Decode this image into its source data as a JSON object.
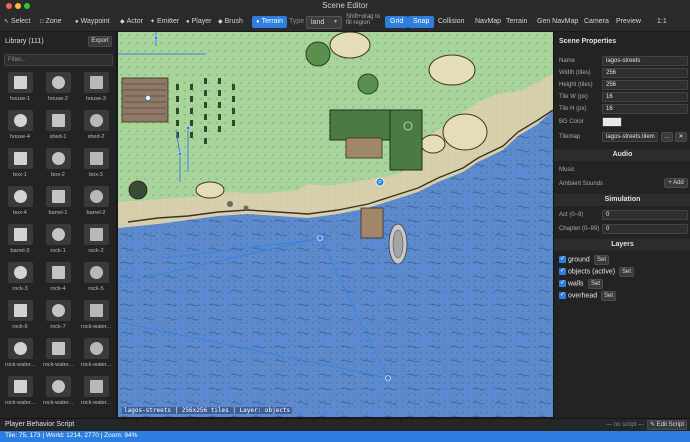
{
  "window": {
    "title": "Scene Editor"
  },
  "toolbar": {
    "select": "Select",
    "zone": "Zone",
    "waypoint": "Waypoint",
    "actor": "Actor",
    "emitter": "Emitter",
    "player": "Player",
    "brush": "Brush",
    "terrain": "Terrain",
    "type_label": "Type",
    "type_value": "land",
    "hint": "Shift+drag to fill region",
    "grid": "Grid",
    "snap": "Snap",
    "collision": "Collision",
    "navmap": "NavMap",
    "terrain2": "Terrain",
    "gen_navmap": "Gen NavMap",
    "camera": "Camera",
    "preview": "Preview",
    "zoom_ratio": "1:1"
  },
  "library": {
    "title": "Library (111)",
    "export": "Export",
    "filter_placeholder": "Filter...",
    "assets": [
      "house-1",
      "house-2",
      "house-3",
      "house-4",
      "shed-1",
      "shed-2",
      "box-1",
      "box-2",
      "box-3",
      "box-4",
      "barrel-1",
      "barrel-2",
      "barrel-3",
      "rock-1",
      "rock-2",
      "rock-3",
      "rock-4",
      "rock-5",
      "rock-6",
      "rock-7",
      "rock-water...",
      "rock-water...",
      "rock-water...",
      "rock-water...",
      "rock-water...",
      "rock-water...",
      "rock-water..."
    ]
  },
  "canvas": {
    "status": "lagos-streets | 256x256 tiles | Layer: objects"
  },
  "properties": {
    "title": "Scene Properties",
    "fields": [
      {
        "label": "Name",
        "value": "lagos-streets"
      },
      {
        "label": "Width (tiles)",
        "value": "256"
      },
      {
        "label": "Height (tiles)",
        "value": "256"
      },
      {
        "label": "Tile W (px)",
        "value": "16"
      },
      {
        "label": "Tile H (px)",
        "value": "16"
      }
    ],
    "bg_color_label": "BG Color",
    "tilemap_label": "Tilemap",
    "tilemap_value": "lagos-streets.tilem",
    "tilemap_browse": "...",
    "tilemap_clear": "✕"
  },
  "audio": {
    "title": "Audio",
    "music_label": "Music",
    "ambient_label": "Ambient Sounds",
    "add": "+ Add"
  },
  "simulation": {
    "title": "Simulation",
    "act_label": "Act (0–9)",
    "act_value": "0",
    "chapter_label": "Chapter (0–99)",
    "chapter_value": "0"
  },
  "layers": {
    "title": "Layers",
    "items": [
      {
        "name": "ground",
        "set": "Set"
      },
      {
        "name": "objects (active)",
        "set": "Set"
      },
      {
        "name": "walls",
        "set": "Set"
      },
      {
        "name": "overhead",
        "set": "Set"
      }
    ]
  },
  "behavior": {
    "label": "Player Behavior Script",
    "no_script": "— no script —",
    "edit": "✎ Edit Script"
  },
  "status": {
    "text": "Tile: 75, 173 | World: 1214, 2770 | Zoom: 94%"
  },
  "colors": {
    "accent": "#2d7ee0",
    "grass": "#a9d59a",
    "sand": "#d8d0ad",
    "water": "#5c8bd0"
  }
}
